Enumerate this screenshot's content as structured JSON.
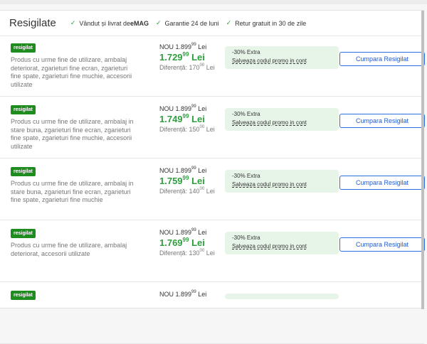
{
  "header": {
    "title": "Resigilate",
    "features": [
      {
        "text": "Vândut și livrat de ",
        "bold": "eMAG"
      },
      {
        "text": "Garantie 24 de luni",
        "bold": ""
      },
      {
        "text": "Retur gratuit in 30 de zile",
        "bold": ""
      }
    ]
  },
  "colors": {
    "green": "#2e9e3e",
    "badge": "#1e8c1e",
    "button_blue": "#2b6ee0",
    "promo_bg": "#e7f5e8"
  },
  "offers": [
    {
      "badge": "resigilat",
      "description": "Produs cu urme fine de utilizare, ambalaj deteriorat, zgarieturi fine ecran, zgarieturi fine spate, zgarieturi fine muchie, accesorii utilizate",
      "old_prefix": "NOU 1.899",
      "old_dec": "99",
      "old_suffix": " Lei",
      "new_int": "1.729",
      "new_dec": "99",
      "new_suffix": " Lei",
      "diff_prefix": "Diferență: 170",
      "diff_dec": "00",
      "diff_suffix": " Lei",
      "promo_extra": "-30% Extra",
      "promo_code": "Salveaza codul promo in cont",
      "button": "Cumpara Resigilat"
    },
    {
      "badge": "resigilat",
      "description": "Produs cu urme fine de utilizare, ambalaj in stare buna, zgarieturi fine ecran, zgarieturi fine spate, zgarieturi fine muchie, accesorii utilizate",
      "old_prefix": "NOU 1.899",
      "old_dec": "99",
      "old_suffix": " Lei",
      "new_int": "1.749",
      "new_dec": "99",
      "new_suffix": " Lei",
      "diff_prefix": "Diferență: 150",
      "diff_dec": "00",
      "diff_suffix": " Lei",
      "promo_extra": "-30% Extra",
      "promo_code": "Salveaza codul promo in cont",
      "button": "Cumpara Resigilat"
    },
    {
      "badge": "resigilat",
      "description": "Produs cu urme fine de utilizare, ambalaj in stare buna, zgarieturi fine ecran, zgarieturi fine spate, zgarieturi fine muchie",
      "old_prefix": "NOU 1.899",
      "old_dec": "99",
      "old_suffix": " Lei",
      "new_int": "1.759",
      "new_dec": "99",
      "new_suffix": " Lei",
      "diff_prefix": "Diferență: 140",
      "diff_dec": "00",
      "diff_suffix": " Lei",
      "promo_extra": "-30% Extra",
      "promo_code": "Salveaza codul promo in cont",
      "button": "Cumpara Resigilat"
    },
    {
      "badge": "resigilat",
      "description": "Produs cu urme fine de utilizare, ambalaj deteriorat, accesorii utilizate",
      "old_prefix": "NOU 1.899",
      "old_dec": "99",
      "old_suffix": " Lei",
      "new_int": "1.769",
      "new_dec": "99",
      "new_suffix": " Lei",
      "diff_prefix": "Diferență: 130",
      "diff_dec": "00",
      "diff_suffix": " Lei",
      "promo_extra": "-30% Extra",
      "promo_code": "Salveaza codul promo in cont",
      "button": "Cumpara Resigilat"
    },
    {
      "badge": "resigilat",
      "description": "",
      "old_prefix": "NOU 1.899",
      "old_dec": "99",
      "old_suffix": " Lei",
      "new_int": "",
      "new_dec": "",
      "new_suffix": "",
      "diff_prefix": "",
      "diff_dec": "",
      "diff_suffix": "",
      "promo_extra": "",
      "promo_code": "",
      "button": ""
    }
  ]
}
